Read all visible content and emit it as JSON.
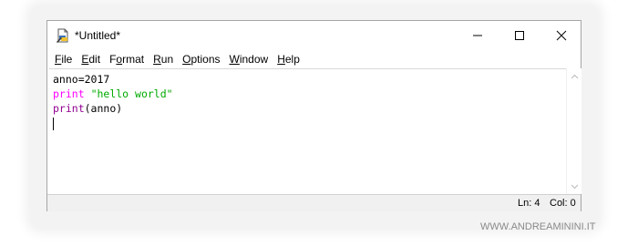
{
  "window": {
    "title": "*Untitled*",
    "controls": {
      "minimize": "–",
      "maximize": "☐",
      "close": "✕"
    },
    "app_icon": "idle-file-icon"
  },
  "menubar": {
    "items": [
      {
        "key": "File",
        "underline": "F",
        "rest": "ile"
      },
      {
        "key": "Edit",
        "underline": "E",
        "rest": "dit"
      },
      {
        "key": "Format",
        "underline": "o",
        "prefix": "F",
        "rest": "rmat"
      },
      {
        "key": "Run",
        "underline": "R",
        "rest": "un"
      },
      {
        "key": "Options",
        "underline": "O",
        "rest": "ptions"
      },
      {
        "key": "Window",
        "underline": "W",
        "rest": "indow"
      },
      {
        "key": "Help",
        "underline": "H",
        "rest": "elp"
      }
    ]
  },
  "editor": {
    "lines": [
      [
        {
          "t": "anno=2017",
          "c": "default"
        }
      ],
      [
        {
          "t": "print",
          "c": "keyword"
        },
        {
          "t": " ",
          "c": "default"
        },
        {
          "t": "\"hello world\"",
          "c": "string"
        }
      ],
      [
        {
          "t": "print",
          "c": "builtin"
        },
        {
          "t": "(anno)",
          "c": "default"
        }
      ]
    ]
  },
  "statusbar": {
    "ln": "Ln: 4",
    "col": "Col: 0"
  },
  "watermark": "WWW.ANDREAMININI.IT",
  "colors": {
    "keyword": "#ff00ff",
    "builtin": "#900090",
    "string": "#00aa00",
    "default": "#000000"
  }
}
